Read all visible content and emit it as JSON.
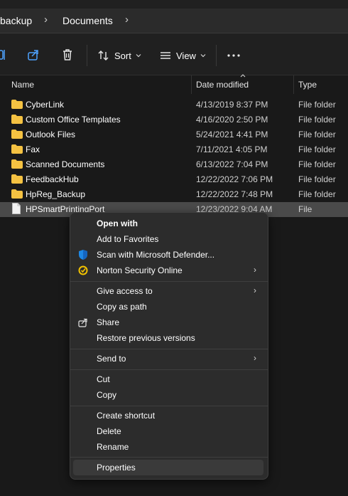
{
  "breadcrumb": {
    "items": [
      "backup",
      "Documents"
    ],
    "separator": "›"
  },
  "toolbar": {
    "sort_label": "Sort",
    "view_label": "View"
  },
  "columns": [
    "Name",
    "Date modified",
    "Type"
  ],
  "files": [
    {
      "name": "CyberLink",
      "date": "4/13/2019 8:37 PM",
      "type": "File folder",
      "icon": "folder-icon"
    },
    {
      "name": "Custom Office Templates",
      "date": "4/16/2020 2:50 PM",
      "type": "File folder",
      "icon": "folder-icon"
    },
    {
      "name": "Outlook Files",
      "date": "5/24/2021 4:41 PM",
      "type": "File folder",
      "icon": "folder-icon"
    },
    {
      "name": "Fax",
      "date": "7/11/2021 4:05 PM",
      "type": "File folder",
      "icon": "folder-icon"
    },
    {
      "name": "Scanned Documents",
      "date": "6/13/2022 7:04 PM",
      "type": "File folder",
      "icon": "folder-icon"
    },
    {
      "name": "FeedbackHub",
      "date": "12/22/2022 7:06 PM",
      "type": "File folder",
      "icon": "folder-icon"
    },
    {
      "name": "HpReg_Backup",
      "date": "12/22/2022 7:48 PM",
      "type": "File folder",
      "icon": "folder-icon"
    },
    {
      "name": "HPSmartPrintingPort",
      "date": "12/23/2022 9:04 AM",
      "type": "File",
      "icon": "file-icon",
      "selected": true
    }
  ],
  "context_menu": {
    "items": [
      {
        "label": "Open with",
        "bold": true
      },
      {
        "label": "Add to Favorites"
      },
      {
        "label": "Scan with Microsoft Defender...",
        "icon": "defender-shield-icon"
      },
      {
        "label": "Norton Security Online",
        "icon": "norton-icon",
        "submenu": true
      },
      {
        "label": "Give access to",
        "submenu": true
      },
      {
        "label": "Copy as path"
      },
      {
        "label": "Share",
        "icon": "share-icon"
      },
      {
        "label": "Restore previous versions"
      },
      {
        "label": "Send to",
        "submenu": true
      },
      {
        "label": "Cut"
      },
      {
        "label": "Copy"
      },
      {
        "label": "Create shortcut"
      },
      {
        "label": "Delete"
      },
      {
        "label": "Rename"
      },
      {
        "label": "Properties",
        "hover": true
      }
    ]
  },
  "colors": {
    "background": "#191919",
    "menu": "#2c2c2c",
    "folder": "#f5c242",
    "defender": "#1e88e5",
    "norton": "#f2c200"
  }
}
